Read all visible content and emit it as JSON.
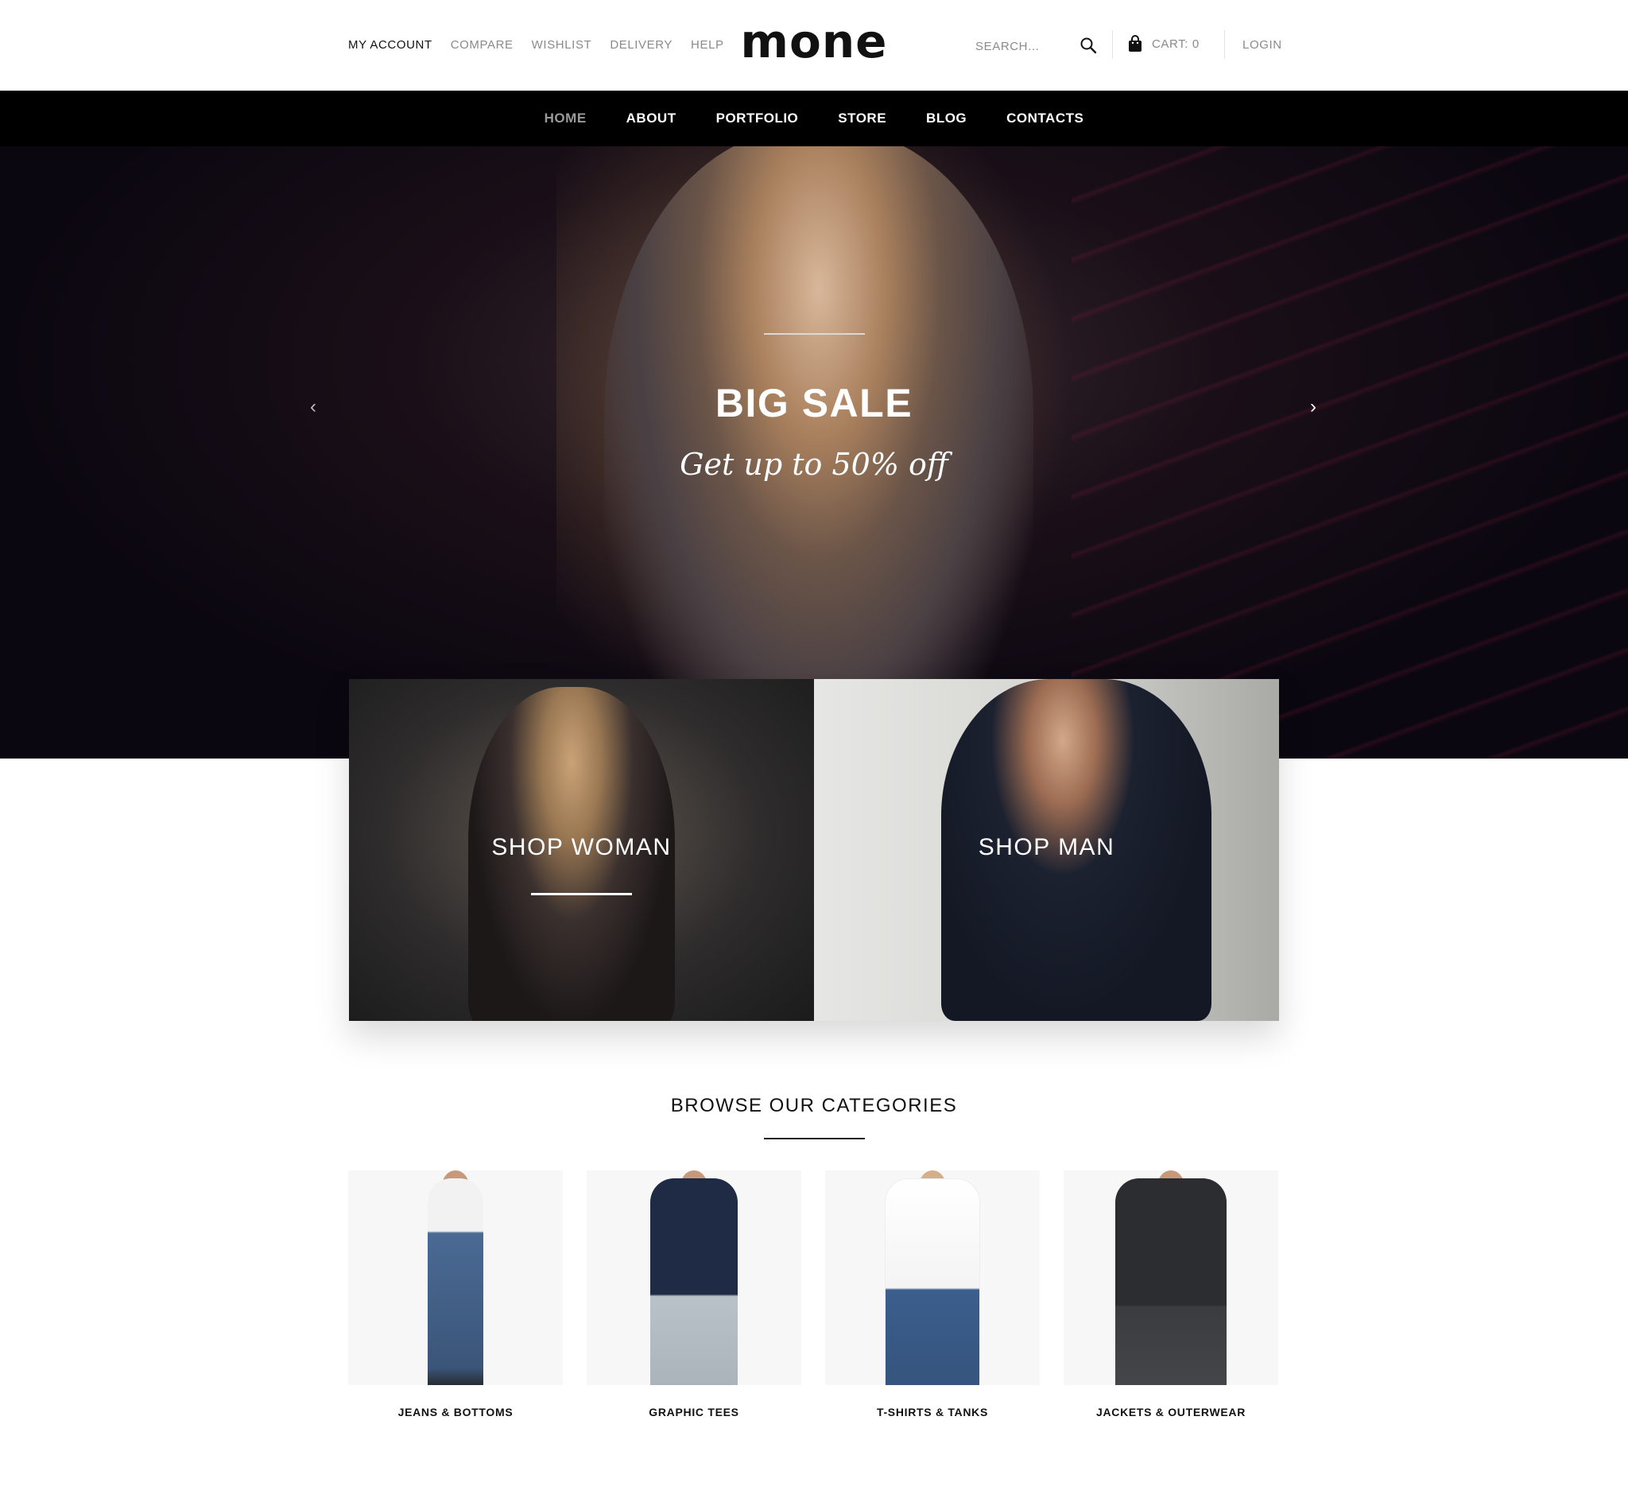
{
  "header": {
    "links": [
      "MY ACCOUNT",
      "COMPARE",
      "WISHLIST",
      "DELIVERY",
      "HELP"
    ],
    "logo": "mone",
    "search_placeholder": "SEARCH...",
    "cart_label": "CART:",
    "cart_count": "0",
    "login_label": "LOGIN"
  },
  "nav": {
    "items": [
      "HOME",
      "ABOUT",
      "PORTFOLIO",
      "STORE",
      "BLOG",
      "CONTACTS"
    ]
  },
  "hero": {
    "title": "BIG SALE",
    "subtitle": "Get up to 50% off"
  },
  "shop": {
    "woman_label": "SHOP WOMAN",
    "man_label": "SHOP MAN"
  },
  "categories": {
    "heading": "BROWSE OUR CATEGORIES",
    "items": [
      {
        "label": "JEANS & BOTTOMS"
      },
      {
        "label": "GRAPHIC TEES"
      },
      {
        "label": "T-SHIRTS & TANKS"
      },
      {
        "label": "JACKETS & OUTERWEAR"
      }
    ]
  },
  "colors": {
    "nav_bg": "#000000",
    "accent_text": "#111111",
    "muted_text": "#8a8a8a",
    "nav_current": "#9a9a9a"
  }
}
